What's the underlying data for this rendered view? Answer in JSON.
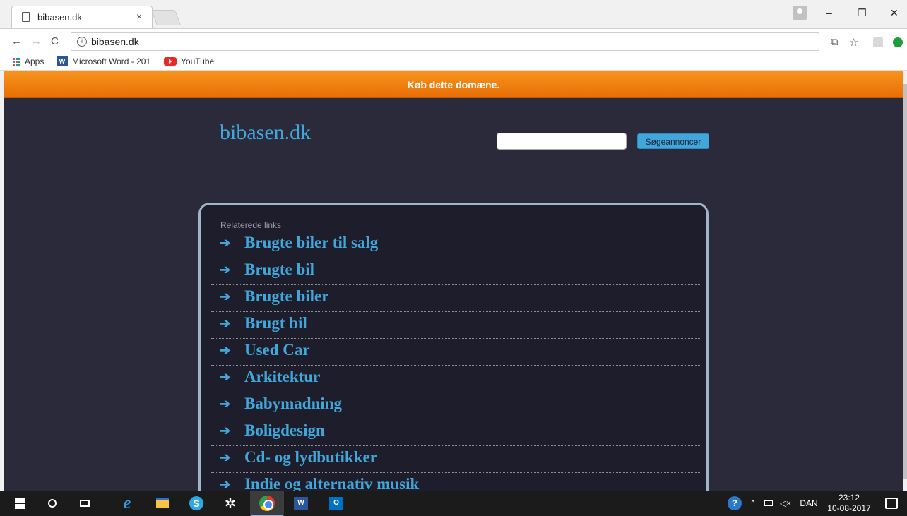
{
  "browser": {
    "tab": {
      "title": "bibasen.dk",
      "close": "×"
    },
    "window_controls": {
      "minimize": "–",
      "restore": "❐",
      "close": "✕"
    },
    "address": {
      "url": "bibasen.dk",
      "info": "i"
    },
    "nav": {
      "back": "←",
      "forward": "→",
      "reload": "C"
    },
    "toolbar_icons": {
      "translate": "⧉",
      "bookmark": "☆"
    },
    "bookmarks": [
      {
        "label": "Apps"
      },
      {
        "label": "Microsoft Word - 201",
        "icon": "W"
      },
      {
        "label": "YouTube"
      }
    ]
  },
  "page": {
    "banner": "Køb dette domæne.",
    "site_title": "bibasen.dk",
    "search": {
      "value": "",
      "button": "Søgeannoncer"
    },
    "links_heading": "Relaterede links",
    "links": [
      "Brugte biler til salg",
      "Brugte bil",
      "Brugte biler",
      "Brugt bil",
      "Used Car",
      "Arkitektur",
      "Babymadning",
      "Boligdesign",
      "Cd- og lydbutikker",
      "Indie og alternativ musik"
    ],
    "arrow": "➔"
  },
  "taskbar": {
    "language": "DAN",
    "time": "23:12",
    "date": "10-08-2017",
    "tray": {
      "chevron": "^",
      "volume": "◁×"
    },
    "icons": {
      "edge": "e",
      "skype": "S",
      "gear": "✲",
      "word": "W",
      "outlook": "O",
      "help": "?"
    }
  },
  "colors": {
    "accent": "#41a6da",
    "banner": "#f7941d",
    "page_bg": "#2b2a3b"
  }
}
